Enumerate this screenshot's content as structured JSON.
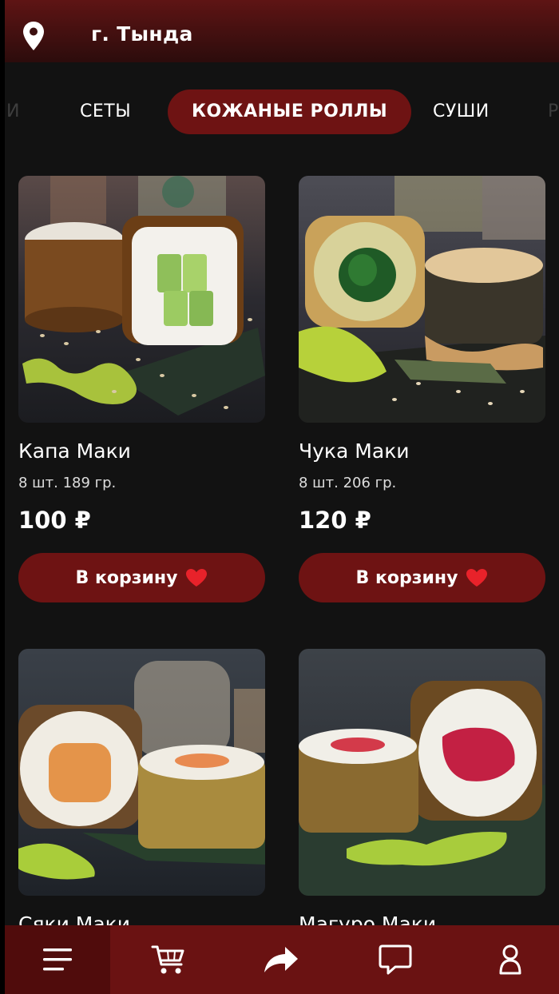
{
  "header": {
    "city": "г. Тында"
  },
  "tabs": [
    {
      "label": "И",
      "state": "faded"
    },
    {
      "label": "СЕТЫ",
      "state": "normal"
    },
    {
      "label": "КОЖАНЫЕ РОЛЛЫ",
      "state": "active"
    },
    {
      "label": "СУШИ",
      "state": "normal"
    },
    {
      "label": "Р",
      "state": "faded"
    }
  ],
  "products": [
    {
      "name": "Капа Маки",
      "meta": "8 шт. 189 гр.",
      "price": "100 ₽",
      "button": "В корзину",
      "filling": "cucumber"
    },
    {
      "name": "Чука Маки",
      "meta": "8 шт. 206 гр.",
      "price": "120 ₽",
      "button": "В корзину",
      "filling": "chuka seaweed"
    },
    {
      "name": "Сяки Маки",
      "filling": "salmon"
    },
    {
      "name": "Магуро Маки",
      "filling": "tuna"
    }
  ],
  "bottom_nav": {
    "items": [
      {
        "icon": "menu-icon"
      },
      {
        "icon": "cart-icon"
      },
      {
        "icon": "share-icon"
      },
      {
        "icon": "chat-icon"
      },
      {
        "icon": "profile-icon"
      }
    ]
  },
  "colors": {
    "accent": "#6e1313",
    "background": "#121212",
    "nav": "#6a1212"
  }
}
